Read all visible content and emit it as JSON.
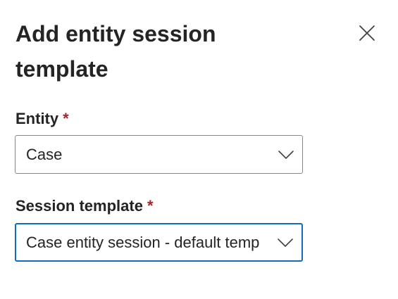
{
  "dialog": {
    "title": "Add entity session template"
  },
  "fields": {
    "entity": {
      "label": "Entity",
      "required_marker": "*",
      "value": "Case"
    },
    "session_template": {
      "label": "Session template",
      "required_marker": "*",
      "value": "Case entity session - default template"
    }
  },
  "icons": {
    "close": "close-icon",
    "dropdown": "chevron-down-icon"
  },
  "colors": {
    "required": "#a4262c",
    "focus_border": "#0f6cbd",
    "border": "#8a8886",
    "text": "#242424"
  }
}
